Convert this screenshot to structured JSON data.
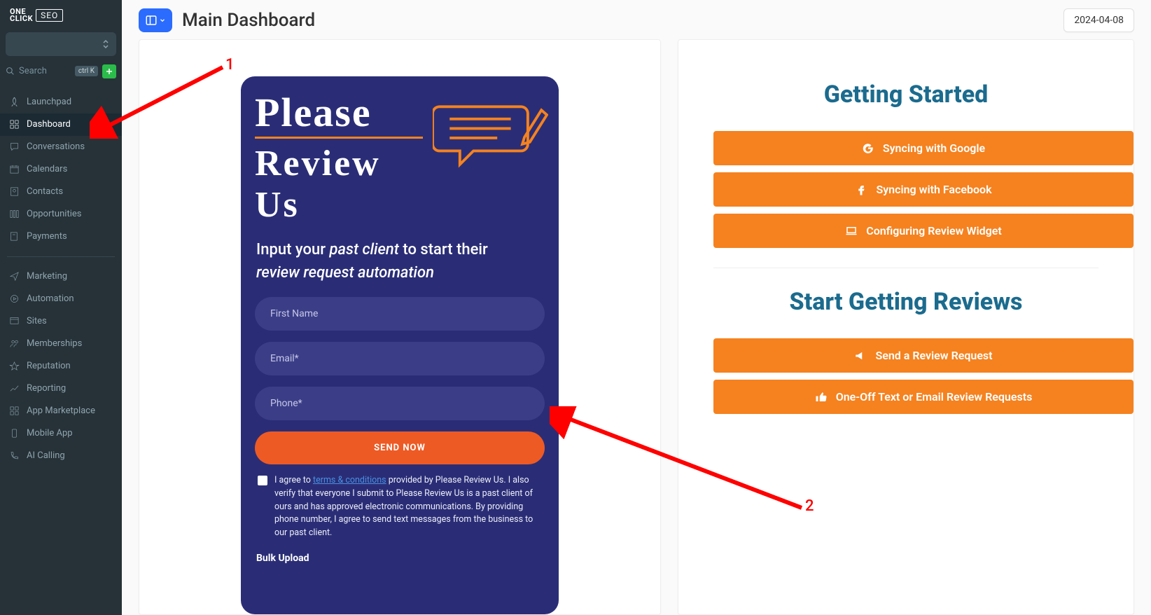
{
  "brand": {
    "line1": "ONE",
    "line2": "CLICK",
    "seo": "SEO"
  },
  "search": {
    "placeholder": "Search",
    "shortcut": "ctrl K"
  },
  "nav": {
    "items": [
      {
        "label": "Launchpad"
      },
      {
        "label": "Dashboard"
      },
      {
        "label": "Conversations"
      },
      {
        "label": "Calendars"
      },
      {
        "label": "Contacts"
      },
      {
        "label": "Opportunities"
      },
      {
        "label": "Payments"
      }
    ],
    "items2": [
      {
        "label": "Marketing"
      },
      {
        "label": "Automation"
      },
      {
        "label": "Sites"
      },
      {
        "label": "Memberships"
      },
      {
        "label": "Reputation"
      },
      {
        "label": "Reporting"
      },
      {
        "label": "App Marketplace"
      },
      {
        "label": "Mobile App"
      },
      {
        "label": "AI Calling"
      }
    ]
  },
  "header": {
    "title": "Main Dashboard",
    "date": "2024-04-08"
  },
  "reviewCard": {
    "please": "Please",
    "review": "Review Us",
    "subtitle_pre": "Input your ",
    "subtitle_em": "past client",
    "subtitle_mid": " to start their ",
    "subtitle_em2": "review request automation",
    "first_name_ph": "First Name",
    "email_ph": "Email*",
    "phone_ph": "Phone*",
    "send": "SEND NOW",
    "consent_pre": "I agree to ",
    "consent_link": "terms & conditions",
    "consent_post": " provided by Please Review Us. I also verify that everyone I submit to Please Review Us is a past client of ours and has approved electronic communications. By providing phone number, I agree to send text messages from the business to our past client.",
    "bulk": "Bulk Upload"
  },
  "rightPanel": {
    "getting_started": "Getting Started",
    "sync_google": "Syncing with Google",
    "sync_facebook": "Syncing with Facebook",
    "config_widget": "Configuring Review Widget",
    "start_reviews": "Start Getting Reviews",
    "send_request": "Send a Review Request",
    "oneoff": "One-Off Text or Email Review Requests"
  },
  "annotations": {
    "one": "1",
    "two": "2"
  }
}
